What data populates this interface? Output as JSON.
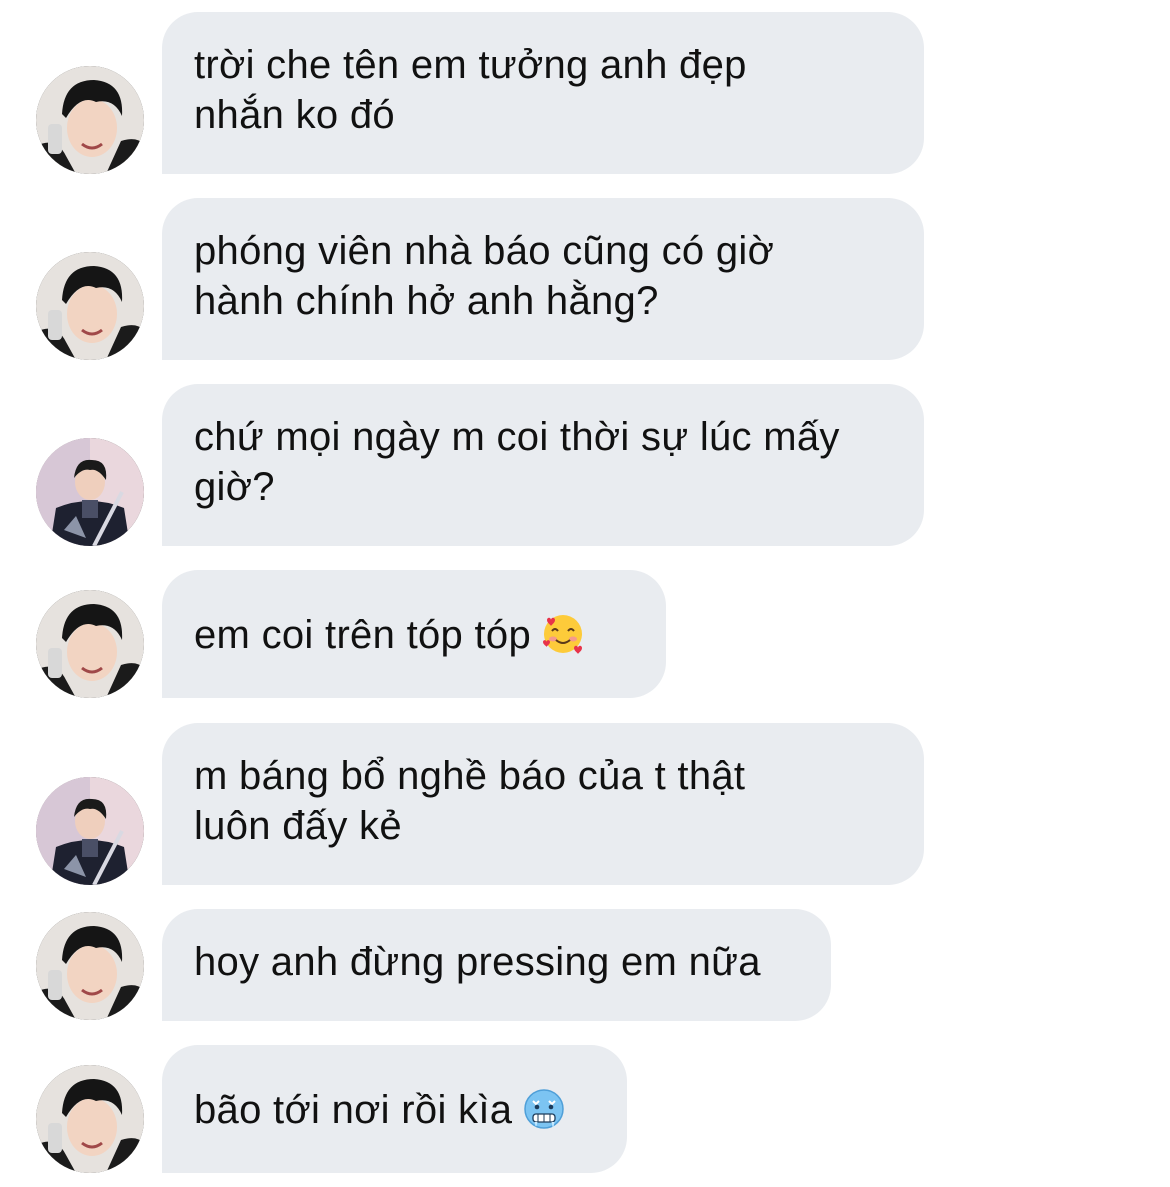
{
  "messages": [
    {
      "avatar": "avatar-a",
      "text": "trời che tên em tưởng anh đẹp\nnhắn ko đó",
      "emoji": null
    },
    {
      "avatar": "avatar-a",
      "text": "phóng viên nhà báo cũng có giờ\nhành chính hở anh hằng?",
      "emoji": null
    },
    {
      "avatar": "avatar-b",
      "text": "chứ mọi ngày m coi thời sự lúc mấy\ngiờ?",
      "emoji": null
    },
    {
      "avatar": "avatar-a",
      "text": "em coi trên tóp tóp",
      "emoji": "smiling-face-with-hearts"
    },
    {
      "avatar": "avatar-b",
      "text": "m báng bổ nghề báo của t thật\nluôn đấy kẻ",
      "emoji": null
    },
    {
      "avatar": "avatar-a",
      "text": "hoy anh đừng pressing em nữa",
      "emoji": null
    },
    {
      "avatar": "avatar-a",
      "text": "bão tới nơi rồi kìa",
      "emoji": "cold-face"
    }
  ]
}
